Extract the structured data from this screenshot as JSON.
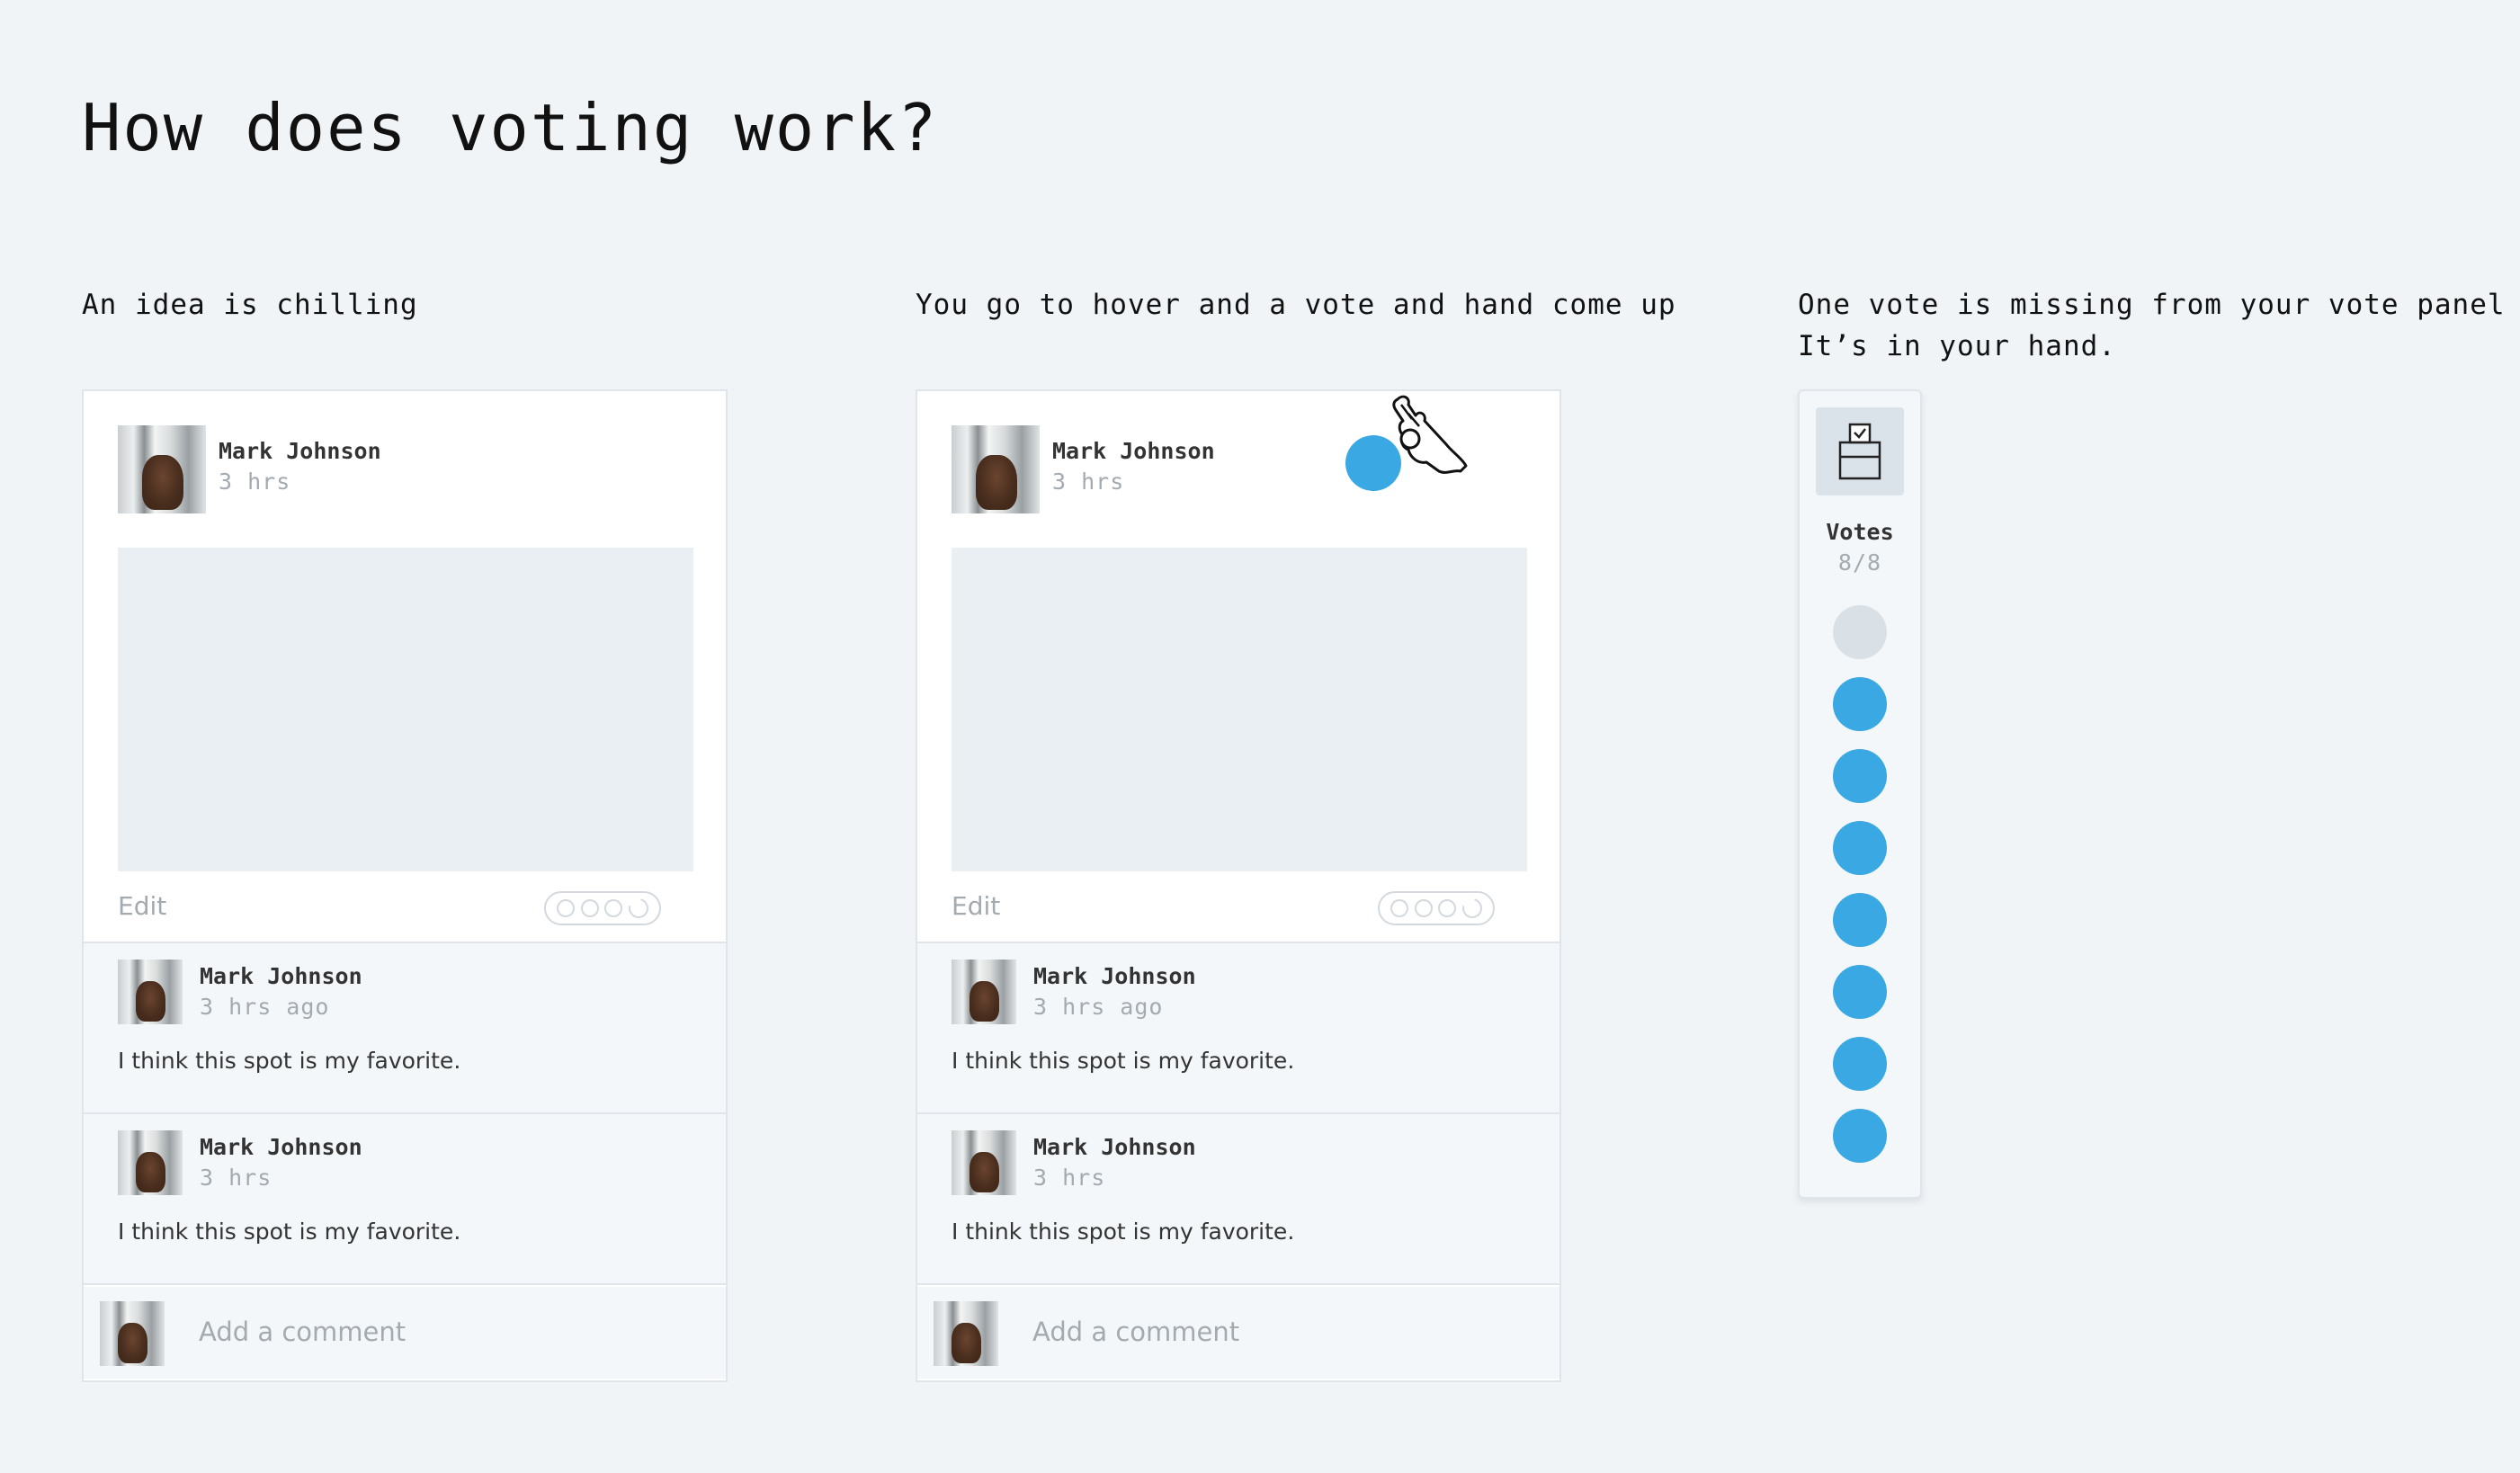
{
  "title": "How does voting work?",
  "steps": [
    {
      "caption": "An idea is chilling",
      "post": {
        "author": "Mark Johnson",
        "time": "3 hrs",
        "edit_label": "Edit",
        "comments": [
          {
            "author": "Mark Johnson",
            "time": "3 hrs ago",
            "text": "I think this spot is my favorite."
          },
          {
            "author": "Mark Johnson",
            "time": "3 hrs",
            "text": "I think this spot is my favorite."
          }
        ],
        "add_comment_placeholder": "Add a comment"
      }
    },
    {
      "caption": "You go to hover and a vote and hand come up",
      "post": {
        "author": "Mark Johnson",
        "time": "3 hrs",
        "edit_label": "Edit",
        "comments": [
          {
            "author": "Mark Johnson",
            "time": "3 hrs ago",
            "text": "I think this spot is my favorite."
          },
          {
            "author": "Mark Johnson",
            "time": "3 hrs",
            "text": "I think this spot is my favorite."
          }
        ],
        "add_comment_placeholder": "Add a comment"
      }
    },
    {
      "caption": "One vote is missing from your vote panel\nIt’s in your hand."
    }
  ],
  "vote_panel": {
    "label": "Votes",
    "count": "8/8",
    "dots": [
      "empty",
      "filled",
      "filled",
      "filled",
      "filled",
      "filled",
      "filled",
      "filled"
    ]
  },
  "colors": {
    "vote_blue": "#3aa8e3",
    "vote_empty": "#d9e1e6",
    "background": "#f0f4f7",
    "muted_text": "#a3aab0"
  },
  "icons": {
    "ballot_box": "ballot-box-icon",
    "hand": "hand-pinch-icon",
    "undo": "undo-icon"
  }
}
